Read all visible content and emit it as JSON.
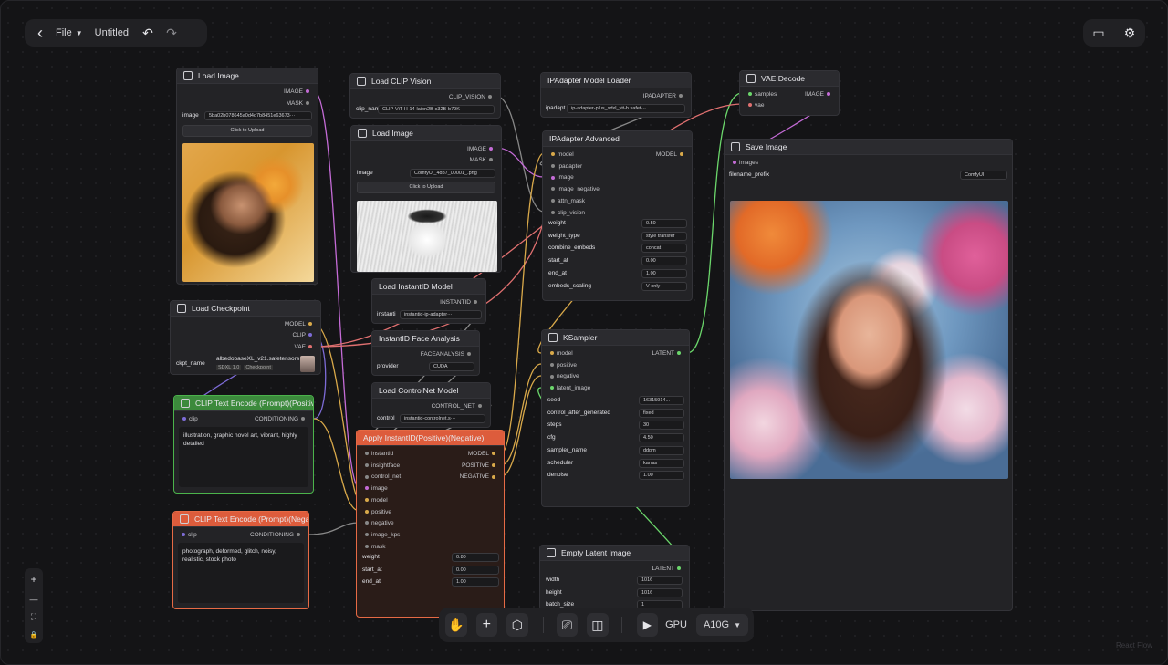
{
  "topbar": {
    "back": "‹",
    "file": "File",
    "title": "Untitled",
    "undo": "↶",
    "redo": "↷"
  },
  "topright": {
    "panel_icon": "▭",
    "settings_icon": "⚙"
  },
  "zoom": {
    "plus": "+",
    "minus": "—",
    "fit": "⛶",
    "lock": "🔒"
  },
  "bottom": {
    "hand": "✋",
    "add": "+",
    "cube": "⬡",
    "terminal": "⎚",
    "layout": "◫",
    "play": "▶",
    "gpu_label": "GPU",
    "gpu_value": "A10G"
  },
  "watermark": "React Flow",
  "nodes": {
    "load_image": {
      "title": "Load Image",
      "out_image": "IMAGE",
      "out_mask": "MASK",
      "image_label": "image",
      "image_value": "5ba02b078645a0d4d7b8451e63673···",
      "upload": "Click to Upload"
    },
    "load_checkpoint": {
      "title": "Load Checkpoint",
      "out_model": "MODEL",
      "out_clip": "CLIP",
      "out_vae": "VAE",
      "ckpt_label": "ckpt_name",
      "ckpt_value": "albedobaseXL_v21.safetensors",
      "tag1": "SDXL 1.0",
      "tag2": "Checkpoint"
    },
    "clip_pos": {
      "title": "CLIP Text Encode (Prompt)(Positive)",
      "in_clip": "clip",
      "out": "CONDITIONING",
      "text": "illustration, graphic novel art, vibrant, highly detailed"
    },
    "clip_neg": {
      "title": "CLIP Text Encode (Prompt)(Negative)",
      "in_clip": "clip",
      "out": "CONDITIONING",
      "text": "photograph, deformed, glitch, noisy, realistic, stock photo"
    },
    "load_clip_vision": {
      "title": "Load CLIP Vision",
      "out": "CLIP_VISION",
      "field_label": "clip_nam",
      "field_value": "CLIP-ViT-H-14-laion2B-s32B-b79K···"
    },
    "load_image2": {
      "title": "Load Image",
      "out_image": "IMAGE",
      "out_mask": "MASK",
      "image_label": "image",
      "image_value": "ComfyUI_4d87_00001_.png",
      "upload": "Click to Upload"
    },
    "instantid_model": {
      "title": "Load InstantID Model",
      "out": "INSTANTID",
      "field_label": "instanti",
      "field_value": "instantid-ip-adapter···"
    },
    "face_analysis": {
      "title": "InstantID Face Analysis",
      "out": "FACEANALYSIS",
      "field_label": "provider",
      "field_value": "CUDA"
    },
    "controlnet": {
      "title": "Load ControlNet Model",
      "out": "CONTROL_NET",
      "field_label": "control_",
      "field_value": "instantid-controlnet.s···"
    },
    "apply_instantid": {
      "title": "Apply InstantID(Positive)(Negative)",
      "inputs": [
        "instantid",
        "insightface",
        "control_net",
        "image",
        "model",
        "positive",
        "negative",
        "image_kps",
        "mask"
      ],
      "outputs": [
        "MODEL",
        "POSITIVE",
        "NEGATIVE"
      ],
      "params": [
        {
          "label": "weight",
          "value": "0.80"
        },
        {
          "label": "start_at",
          "value": "0.00"
        },
        {
          "label": "end_at",
          "value": "1.00"
        }
      ]
    },
    "ipadapter_loader": {
      "title": "IPAdapter Model Loader",
      "out": "IPADAPTER",
      "field_label": "ipadapt",
      "field_value": "ip-adapter-plus_sdxl_vit-h.safet···"
    },
    "ipadapter_adv": {
      "title": "IPAdapter Advanced",
      "out": "MODEL",
      "inputs": [
        "model",
        "ipadapter",
        "image",
        "image_negative",
        "attn_mask",
        "clip_vision"
      ],
      "params": [
        {
          "label": "weight",
          "value": "0.50"
        },
        {
          "label": "weight_type",
          "value": "style transfer"
        },
        {
          "label": "combine_embeds",
          "value": "concat"
        },
        {
          "label": "start_at",
          "value": "0.00"
        },
        {
          "label": "end_at",
          "value": "1.00"
        },
        {
          "label": "embeds_scaling",
          "value": "V only"
        }
      ]
    },
    "ksampler": {
      "title": "KSampler",
      "out": "LATENT",
      "inputs": [
        "model",
        "positive",
        "negative",
        "latent_image"
      ],
      "params": [
        {
          "label": "seed",
          "value": "16315914..."
        },
        {
          "label": "control_after_generated",
          "value": "fixed"
        },
        {
          "label": "steps",
          "value": "30"
        },
        {
          "label": "cfg",
          "value": "4.50"
        },
        {
          "label": "sampler_name",
          "value": "ddpm"
        },
        {
          "label": "scheduler",
          "value": "karras"
        },
        {
          "label": "denoise",
          "value": "1.00"
        }
      ]
    },
    "empty_latent": {
      "title": "Empty Latent Image",
      "out": "LATENT",
      "params": [
        {
          "label": "width",
          "value": "1016"
        },
        {
          "label": "height",
          "value": "1016"
        },
        {
          "label": "batch_size",
          "value": "1"
        }
      ]
    },
    "vae_decode": {
      "title": "VAE Decode",
      "in_samples": "samples",
      "in_vae": "vae",
      "out": "IMAGE"
    },
    "save_image": {
      "title": "Save Image",
      "in_images": "images",
      "prefix_label": "filename_prefix",
      "prefix_value": "ComfyUI"
    }
  }
}
